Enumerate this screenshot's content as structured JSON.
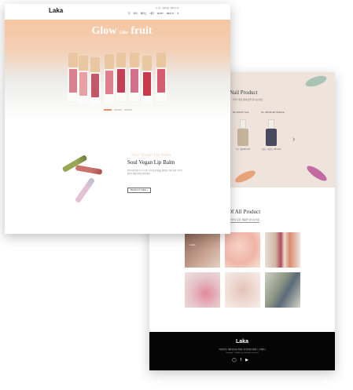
{
  "front_page": {
    "logo": "Laka",
    "util_links": "로그인 · 회원가입 · 장바구니 0",
    "nav_items": [
      "립",
      "아이",
      "페이스",
      "네일",
      "SHOP",
      "ABOUT"
    ],
    "hero": {
      "title_1": "Glow",
      "title_2": "Like",
      "title_3": "fruit",
      "tint_colors": [
        "#d8818c",
        "#e8a0a3",
        "#c4586b",
        "#e07f8c",
        "#c53e55",
        "#d0708a",
        "#c63a4b",
        "#d65c6f"
      ]
    },
    "slider_dots": [
      true,
      false,
      false
    ],
    "balm": {
      "script_text": "Soul Vegan Lip Balm",
      "title": "Soul Vegan Lip Balm",
      "description": "천연 유래 성분으로 부드럽고 촉촉하게 입술을 케어하는 비건 립밤. 은은한 컬러로 데일리하게 사용하세요.",
      "button_label": "PRODUCT VIEW +",
      "stick_colors": [
        "#9aa856",
        "#c9736b",
        "#e4c2d5"
      ]
    }
  },
  "back_page": {
    "nail": {
      "title": "Nail Product",
      "subtitle": "라카 네일 컬렉션을 만나보세요",
      "products": [
        {
          "label": "NO. MOODY NAIL",
          "color": "#c4b39a",
          "caption": "무디 네일\n₩ 9,000"
        },
        {
          "label": "NO. WRINKLED SILENCE",
          "color": "#4a4a5e",
          "caption": "링클드 사일런스\n₩ 9,000"
        }
      ],
      "swatch_colors": [
        "#a9c4b4",
        "#e9a37a",
        "#c46aa2"
      ]
    },
    "all_product": {
      "title": "Of All Product",
      "subtitle": "라카의 모든 제품을 만나보세요",
      "tile_text": "LAKA",
      "tile_colors": [
        "#b58a77",
        "#f0b4a8",
        "#d9c4b4",
        "#e6c3c8",
        "#efdcd4",
        "#a3a891"
      ]
    },
    "footer": {
      "logo": "Laka",
      "links": "이용약관 | 개인정보처리방침 | 사업자정보확인 | 고객센터",
      "copyright": "Copyright © LAKA Corp. All rights reserved.",
      "icons": [
        "instagram-icon",
        "facebook-icon",
        "youtube-icon"
      ]
    }
  }
}
